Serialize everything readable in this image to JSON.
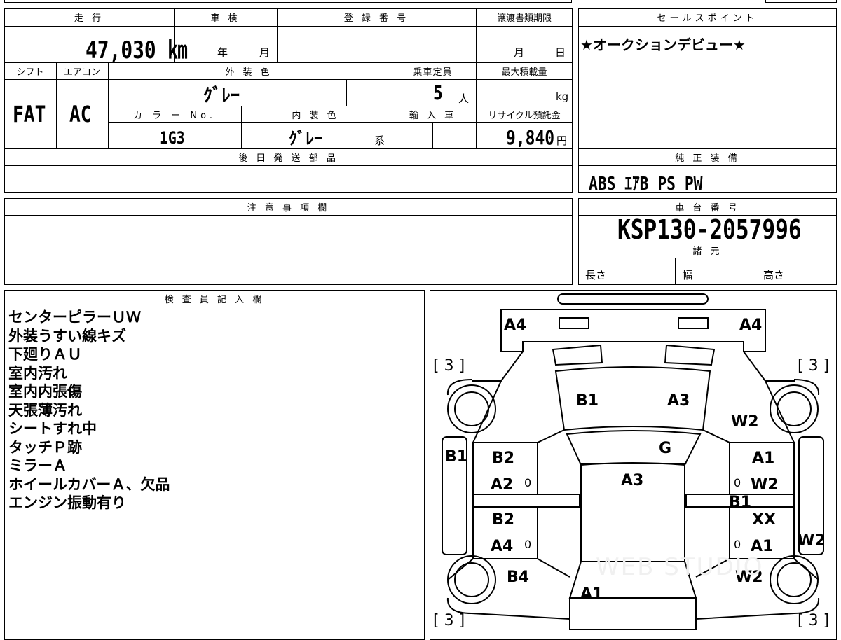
{
  "info": {
    "mileage_label": "走 行",
    "mileage": "47,030 ㎞",
    "inspection_label": "車 検",
    "inspection_year": "年",
    "inspection_month": "月",
    "registration_label": "登 録 番 号",
    "transfer_label": "譲渡書類期限",
    "transfer_month": "月",
    "transfer_day": "日",
    "shift_label": "シフト",
    "aircon_label": "エアコン",
    "exterior_color_label": "外 装 色",
    "seating_label": "乗車定員",
    "max_load_label": "最大積載量",
    "shift": "FAT",
    "aircon": "AC",
    "exterior_color": "ｸﾞﾚｰ",
    "seating": "5",
    "seating_unit": "人",
    "max_load_unit": "kg",
    "color_no_label": "カ ラ ー No.",
    "interior_color_label": "内 装 色",
    "import_label": "輸 入 車",
    "recycle_label": "リサイクル預託金",
    "color_no": "1G3",
    "interior_color": "ｸﾞﾚｰ",
    "interior_suffix": "系",
    "recycle_fee": "9,840",
    "recycle_unit": "円",
    "later_parts_label": "後 日 発 送 部 品"
  },
  "sales": {
    "label": "セールスポイント",
    "text": "★オークションデビュー★"
  },
  "equipment": {
    "label": "純 正 装 備",
    "text": "ABS ｴｱB PS PW"
  },
  "notes": {
    "label": "注 意 事 項 欄"
  },
  "chassis": {
    "label": "車 台 番 号",
    "number": "KSP130-2057996",
    "spec_label": "諸 元",
    "length_label": "長さ",
    "width_label": "幅",
    "height_label": "高さ"
  },
  "inspector": {
    "label": "検 査 員 記 入 欄",
    "lines": [
      "センターピラーＵＷ",
      "外装うすい線キズ",
      "下廻りＡＵ",
      "室内汚れ",
      "室内内張傷",
      "天張薄汚れ",
      "シートすれ中",
      "タッチＰ跡",
      "ミラーＡ",
      "ホイールカバーＡ、欠品",
      "エンジン振動有り"
    ]
  },
  "diagram": {
    "tire_marks": [
      "[ 3 ]",
      "[ 3 ]",
      "[ 3 ]",
      "[ 3 ]"
    ],
    "marks": {
      "bumper_left": "A4",
      "bumper_right": "A4",
      "hood_left": "B1",
      "hood_right": "A3",
      "fender_right": "W2",
      "windshield": "G",
      "roof": "A3",
      "sill_left": "B1",
      "front_door_left_1": "B2",
      "front_door_left_2": "A2",
      "rear_door_left_1": "B2",
      "rear_door_left_2": "A4",
      "front_door_right_1": "A1",
      "front_door_right_2": "W2",
      "pillar_right": "B1",
      "rear_door_right_1": "XX",
      "rear_door_right_2": "A1",
      "sill_right": "W2",
      "rear_fender_left": "B4",
      "trunk": "A1",
      "rear_fender_right": "W2"
    },
    "zero": "0",
    "watermark": "WEB STUDIO"
  }
}
